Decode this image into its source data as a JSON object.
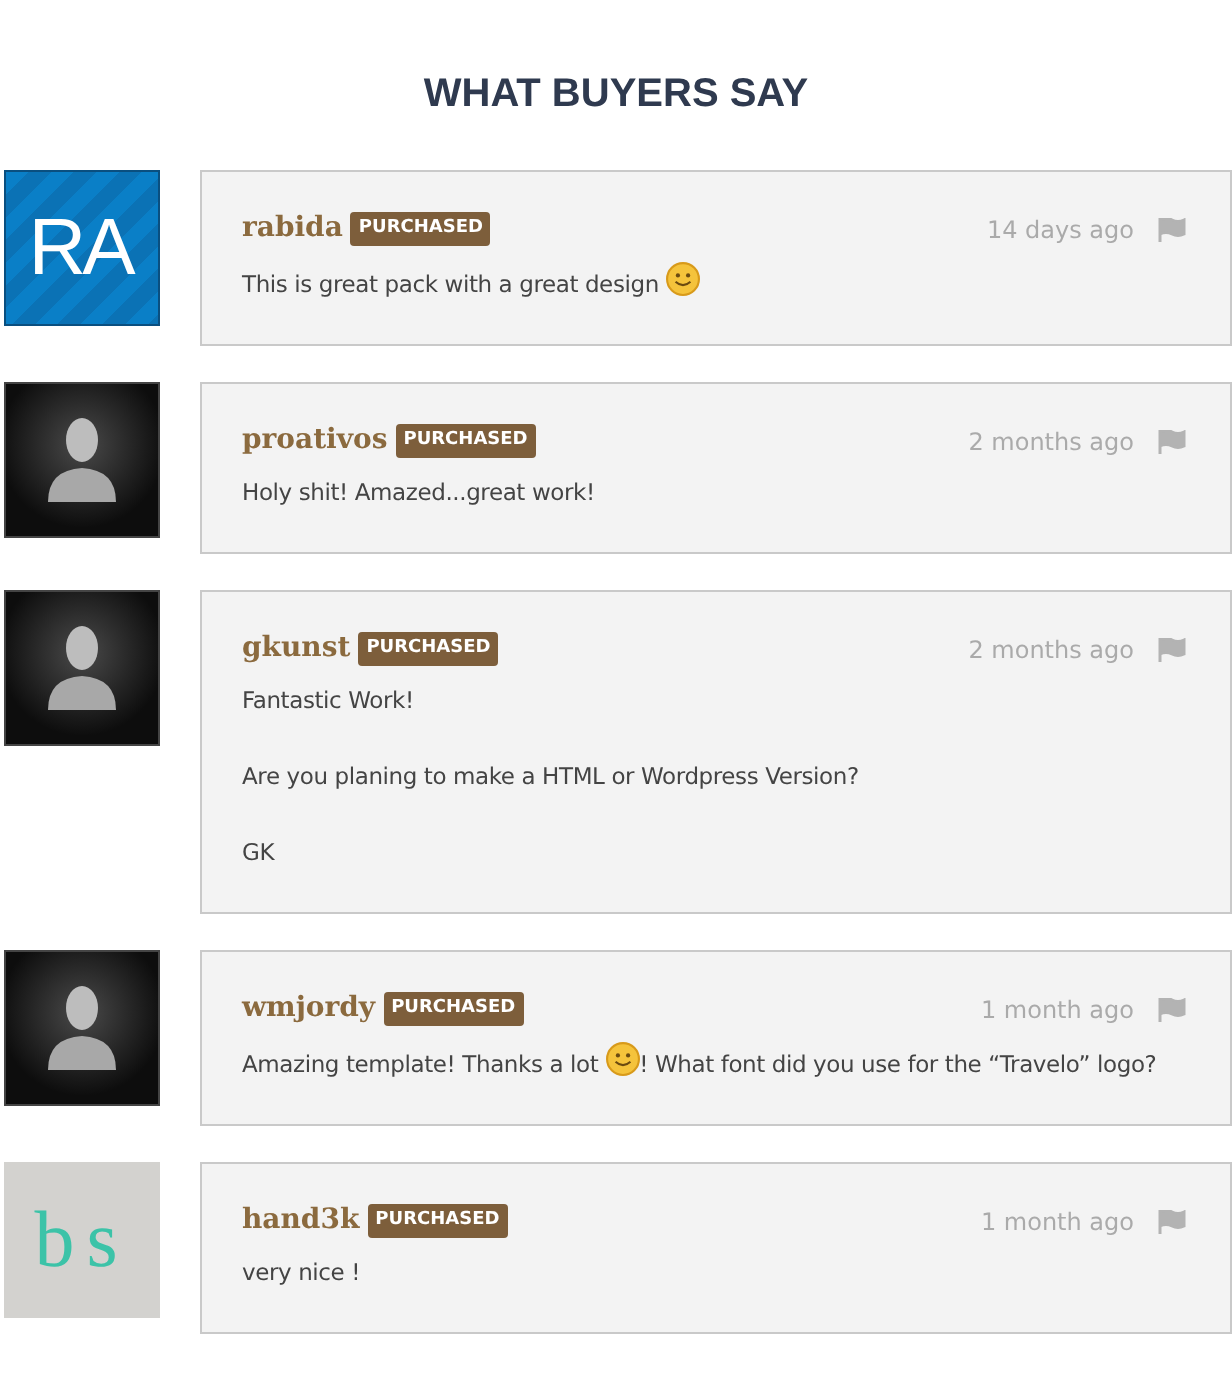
{
  "heading": "WHAT BUYERS SAY",
  "reviews": [
    {
      "avatar": {
        "kind": "initials",
        "text": "RA"
      },
      "name": "rabida",
      "badge": "PURCHASED",
      "time": "14 days ago",
      "paragraphs": [
        [
          {
            "kind": "text",
            "text": "This is great pack with a great design "
          },
          {
            "kind": "smiley"
          }
        ]
      ]
    },
    {
      "avatar": {
        "kind": "silhouette"
      },
      "name": "proativos",
      "badge": "PURCHASED",
      "time": "2 months ago",
      "paragraphs": [
        [
          {
            "kind": "text",
            "text": "Holy shit! Amazed...great work!"
          }
        ]
      ]
    },
    {
      "avatar": {
        "kind": "silhouette"
      },
      "name": "gkunst",
      "badge": "PURCHASED",
      "time": "2 months ago",
      "paragraphs": [
        [
          {
            "kind": "text",
            "text": "Fantastic Work!"
          }
        ],
        [
          {
            "kind": "text",
            "text": "Are you planing to make a HTML or Wordpress Version?"
          }
        ],
        [
          {
            "kind": "text",
            "text": "GK"
          }
        ]
      ]
    },
    {
      "avatar": {
        "kind": "silhouette"
      },
      "name": "wmjordy",
      "badge": "PURCHASED",
      "time": "1 month ago",
      "paragraphs": [
        [
          {
            "kind": "text",
            "text": "Amazing template! Thanks a lot "
          },
          {
            "kind": "smiley"
          },
          {
            "kind": "text",
            "text": "! What font did you use for the “Travelo” logo?"
          }
        ]
      ]
    },
    {
      "avatar": {
        "kind": "monogram",
        "text": "bs"
      },
      "name": "hand3k",
      "badge": "PURCHASED",
      "time": "1 month ago",
      "paragraphs": [
        [
          {
            "kind": "text",
            "text": "very nice !"
          }
        ]
      ]
    }
  ]
}
